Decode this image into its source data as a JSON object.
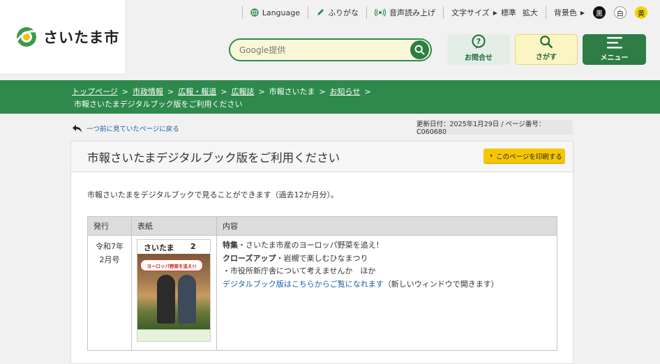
{
  "logo": {
    "text": "さいたま市"
  },
  "utility": {
    "language": "Language",
    "furigana": "ふりがな",
    "read_aloud": "音声読み上げ",
    "text_size_label": "文字サイズ",
    "text_size_standard": "標準",
    "text_size_large": "拡大",
    "bg_color_label": "背景色",
    "bg_black": "黒",
    "bg_white": "白",
    "bg_yellow": "黄"
  },
  "search": {
    "placeholder": "Google提供"
  },
  "tiles": {
    "inquiry": "お問合せ",
    "search": "さがす",
    "menu": "メニュー"
  },
  "breadcrumb": {
    "items": [
      "トップページ",
      "市政情報",
      "広報・報道",
      "広報誌"
    ],
    "plain": "市報さいたま",
    "last_link": "お知らせ",
    "current": "市報さいたまデジタルブック版をご利用ください"
  },
  "back_link": "一つ前に見ていたページに戻る",
  "updated": "更新日付：2025年1月29日 / ページ番号：C060680",
  "page": {
    "title": "市報さいたまデジタルブック版をご利用ください",
    "print_button": "このページを印刷する",
    "lead": "市報さいたまをデジタルブックで見ることができます（過去12か月分）。"
  },
  "table": {
    "headers": [
      "発行",
      "表紙",
      "内容"
    ],
    "rows": [
      {
        "date_line1": "令和7年",
        "date_line2": "2月号",
        "cover": {
          "brand": "さいたま",
          "issue": "2",
          "headline": "ヨーロッパ野菜を追え!!"
        },
        "feature_label": "特集",
        "feature_text": "・さいたま市産のヨーロッパ野菜を追え！",
        "closeup_label": "クローズアップ",
        "closeup_text": "・岩槻で楽しむひなまつり",
        "other_text": "・市役所新庁舎について考えませんか　ほか",
        "digital_link": "デジタルブック版はこちらからご覧になれます",
        "note": "（新しいウィンドウで開きます）"
      }
    ]
  },
  "colors": {
    "primary_green": "#2e8a4c",
    "accent_yellow": "#f6c600"
  }
}
